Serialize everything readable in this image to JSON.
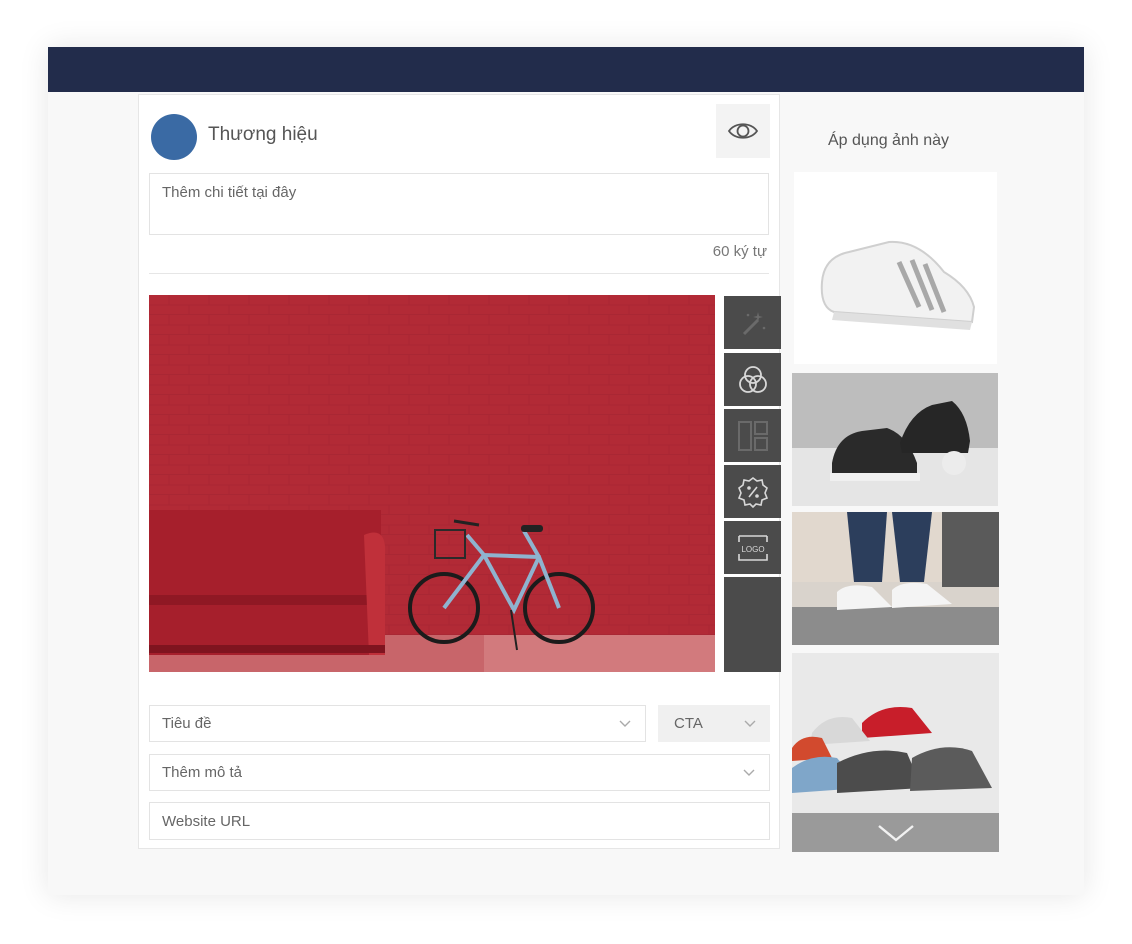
{
  "post": {
    "brand_name": "Thương hiệu",
    "details_placeholder": "Thêm chi tiết tại đây",
    "char_counter": "60 ký tự",
    "preview_icon": "eye-icon"
  },
  "toolbar": {
    "tools": [
      "magic-wand-icon",
      "color-filter-icon",
      "layout-icon",
      "discount-badge-icon",
      "logo-icon"
    ],
    "logo_label": "LOGO"
  },
  "form": {
    "title_placeholder": "Tiêu đề",
    "cta_label": "CTA",
    "description_placeholder": "Thêm mô tả",
    "url_placeholder": "Website URL"
  },
  "gallery": {
    "heading": "Áp dụng ảnh này",
    "more_icon": "chevron-down-icon"
  },
  "colors": {
    "header": "#222c4b",
    "avatar": "#3a6aa4",
    "toolbar": "#4b4b4b",
    "wall": "#b02a35"
  }
}
